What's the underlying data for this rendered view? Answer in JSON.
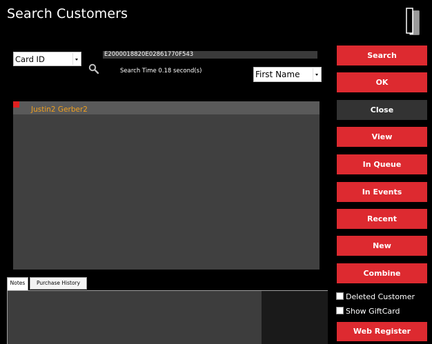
{
  "window": {
    "title": "Search Customers",
    "exit_icon": "door-exit-icon"
  },
  "search": {
    "field_select": "Card ID",
    "card_value": "E2000018820E02861770F543",
    "search_time": "Search Time 0.18 second(s)",
    "sort_select": "First Name",
    "search_icon": "magnifier-icon"
  },
  "results": [
    {
      "name": "Justin2 Gerber2",
      "marker_color": "#e02020"
    }
  ],
  "tabs": [
    {
      "label": "Notes",
      "active": true
    },
    {
      "label": "Purchase History",
      "active": false
    }
  ],
  "buttons": {
    "search": "Search",
    "ok": "OK",
    "close": "Close",
    "view": "View",
    "in_queue": "In Queue",
    "in_events": "In Events",
    "recent": "Recent",
    "new": "New",
    "combine": "Combine",
    "web_register": "Web Register"
  },
  "checkboxes": {
    "deleted_customer": {
      "label": "Deleted Customer",
      "checked": false
    },
    "show_giftcard": {
      "label": "Show GiftCard",
      "checked": false
    }
  },
  "colors": {
    "accent_red": "#dd2a30",
    "dark_button": "#333333",
    "result_name": "#f0a020"
  }
}
